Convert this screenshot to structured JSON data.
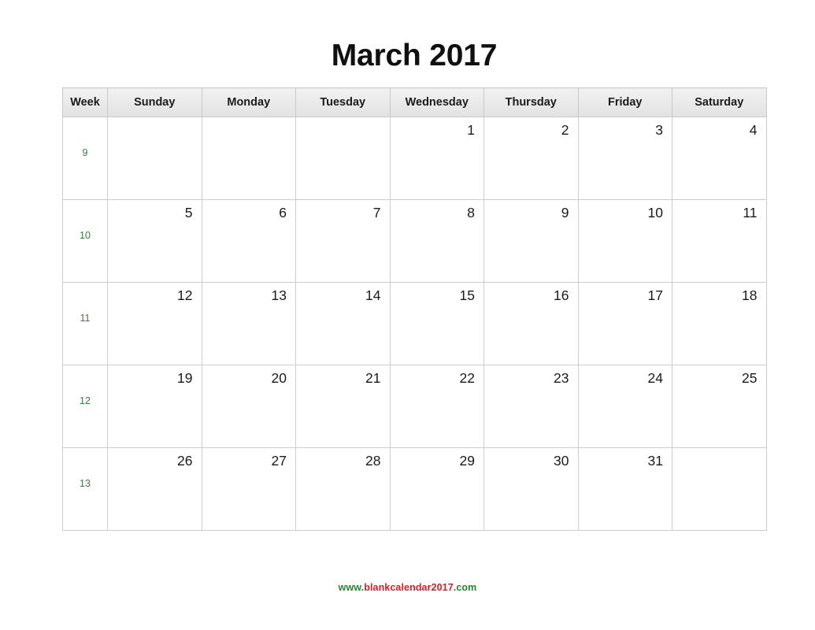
{
  "page": {
    "title": "March 2017",
    "month": "March",
    "year": "2017"
  },
  "colors": {
    "week_number": "#3a7a43",
    "date_text": "#1a1a1a",
    "header_background": "#eaeaea",
    "border": "#cdcdcd",
    "footer_green": "#1f8a26",
    "footer_red": "#e01b24"
  },
  "table": {
    "headers": [
      "Week",
      "Sunday",
      "Monday",
      "Tuesday",
      "Wednesday",
      "Thursday",
      "Friday",
      "Saturday"
    ],
    "rows": [
      {
        "week": "9",
        "days": [
          "",
          "",
          "",
          "1",
          "2",
          "3",
          "4"
        ]
      },
      {
        "week": "10",
        "days": [
          "5",
          "6",
          "7",
          "8",
          "9",
          "10",
          "11"
        ]
      },
      {
        "week": "11",
        "days": [
          "12",
          "13",
          "14",
          "15",
          "16",
          "17",
          "18"
        ]
      },
      {
        "week": "12",
        "days": [
          "19",
          "20",
          "21",
          "22",
          "23",
          "24",
          "25"
        ]
      },
      {
        "week": "13",
        "days": [
          "26",
          "27",
          "28",
          "29",
          "30",
          "31",
          ""
        ]
      }
    ]
  },
  "footer": {
    "prefix": "www.",
    "domain": "blankcalendar2017",
    "tld": ".com",
    "full": "www.blankcalendar2017.com"
  }
}
